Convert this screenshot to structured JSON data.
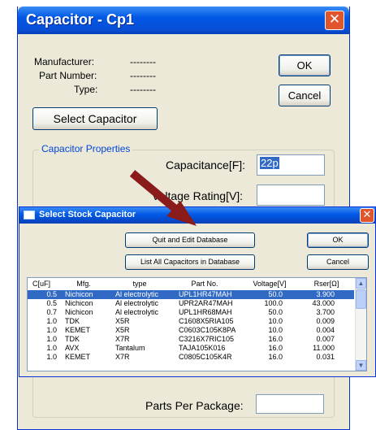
{
  "back_dialog": {
    "title": "Capacitor - Cp1",
    "close_glyph": "✕",
    "manufacturer_label": "Manufacturer:",
    "manufacturer_value": "--------",
    "part_number_label": "Part Number:",
    "part_number_value": "--------",
    "type_label": "Type:",
    "type_value": "--------",
    "ok_label": "OK",
    "cancel_label": "Cancel",
    "select_capacitor_label": "Select Capacitor",
    "group_title": "Capacitor Properties",
    "capacitance_label": "Capacitance[F]:",
    "capacitance_value": "22p",
    "voltage_label": "Voltage Rating[V]:",
    "parts_per_package_label": "Parts Per Package:"
  },
  "stock_dialog": {
    "title": "Select Stock Capacitor",
    "close_glyph": "✕",
    "quit_edit_label": "Quit and Edit Database",
    "list_all_label": "List All Capacitors in Database",
    "ok_label": "OK",
    "cancel_label": "Cancel",
    "columns": [
      "C[uF]",
      "Mfg.",
      "type",
      "Part No.",
      "Voltage[V]",
      "Rser[Ω]"
    ],
    "rows": [
      [
        "0.5",
        "Nichicon",
        "Al electrolytic",
        "UPL1HR47MAH",
        "50.0",
        "3.900"
      ],
      [
        "0.5",
        "Nichicon",
        "Al electrolytic",
        "UPR2AR47MAH",
        "100.0",
        "43.000"
      ],
      [
        "0.7",
        "Nichicon",
        "Al electrolytic",
        "UPL1HR68MAH",
        "50.0",
        "3.700"
      ],
      [
        "1.0",
        "TDK",
        "X5R",
        "C1608X5RIA105",
        "10.0",
        "0.009"
      ],
      [
        "1.0",
        "KEMET",
        "X5R",
        "C0603C105K8PA",
        "10.0",
        "0.004"
      ],
      [
        "1.0",
        "TDK",
        "X7R",
        "C3216X7RIC105",
        "16.0",
        "0.007"
      ],
      [
        "1.0",
        "AVX",
        "Tantalum",
        "TAJA105K016",
        "16.0",
        "11.000"
      ],
      [
        "1.0",
        "KEMET",
        "X7R",
        "C0805C105K4R",
        "16.0",
        "0.031"
      ]
    ],
    "selected_row": 0,
    "scroll_up_glyph": "▲",
    "scroll_down_glyph": "▼"
  },
  "colors": {
    "accent_title": "#0058e6",
    "arrow": "#8b1a1a",
    "selection": "#316ac5"
  }
}
